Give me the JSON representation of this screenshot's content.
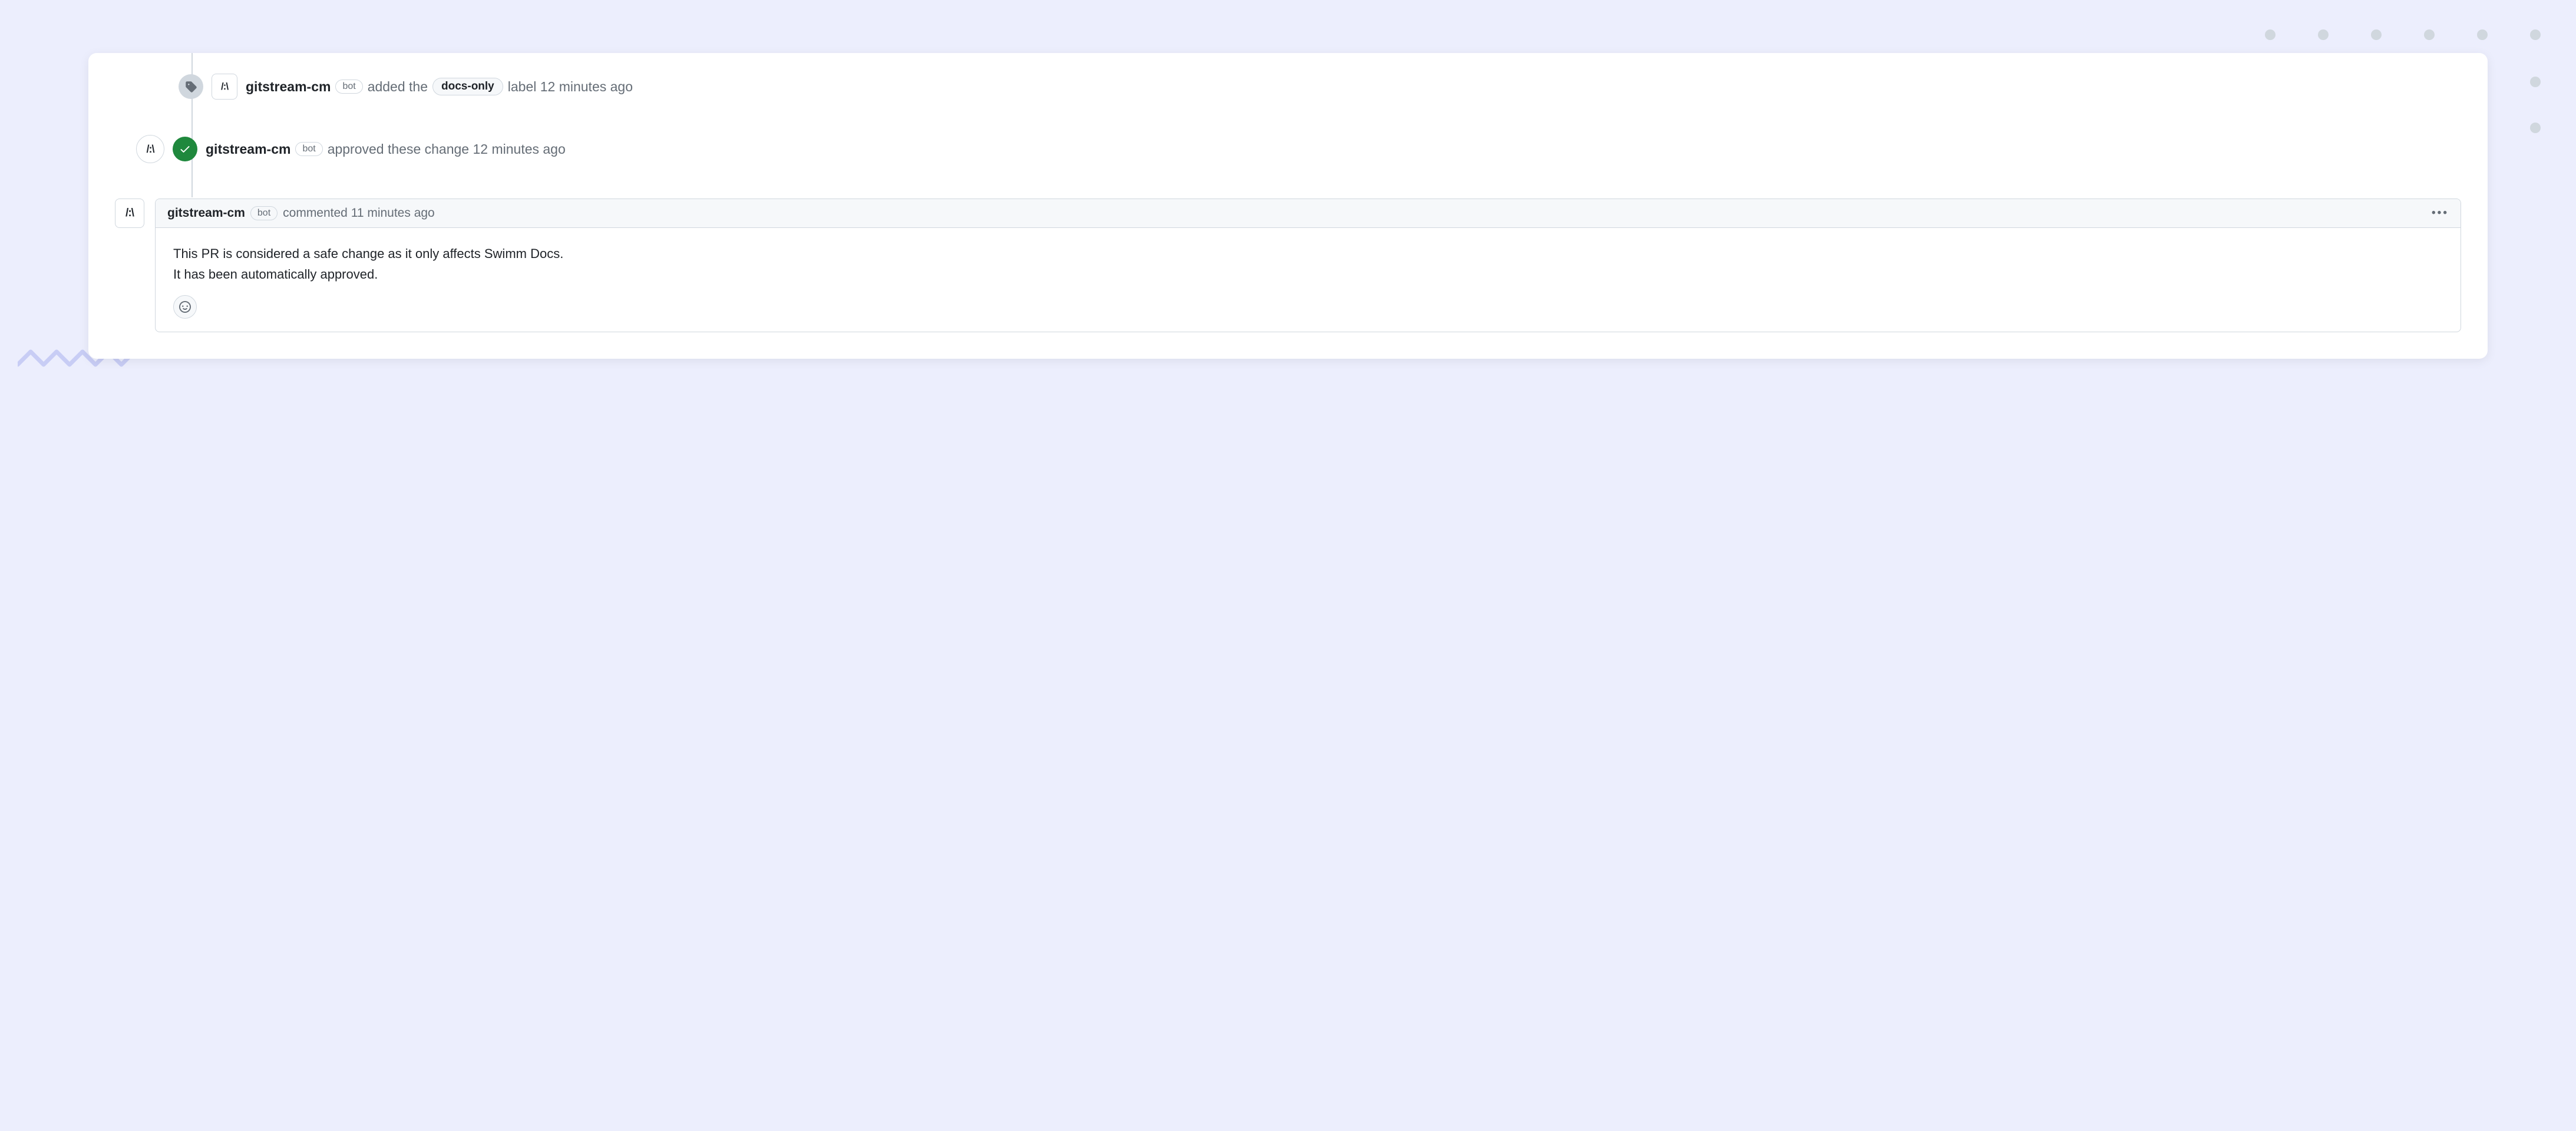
{
  "avatar_text": "/:\\",
  "events": [
    {
      "actor": "gitstream-cm",
      "bot": "bot",
      "text_before": "added the",
      "label": "docs-only",
      "text_after": "label 12 minutes ago"
    },
    {
      "actor": "gitstream-cm",
      "bot": "bot",
      "text": "approved these change 12 minutes ago"
    }
  ],
  "comment": {
    "actor": "gitstream-cm",
    "bot": "bot",
    "meta": "commented 11 minutes ago",
    "body_line1": "This PR is considered a safe change as it only affects Swimm Docs.",
    "body_line2": "It has been automatically approved."
  }
}
